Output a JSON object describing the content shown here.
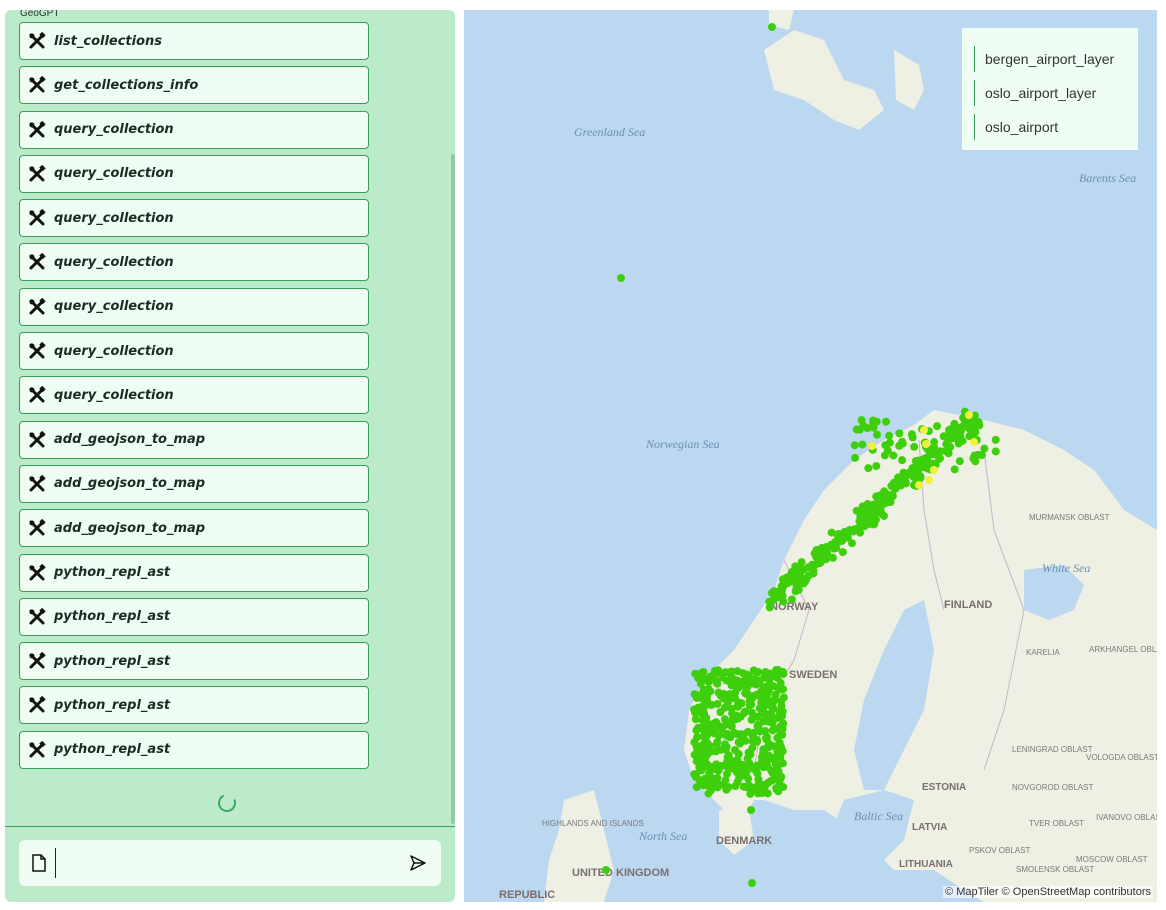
{
  "app": {
    "title": "GeoGPT"
  },
  "tools": [
    "list_collections",
    "get_collections_info",
    "query_collection",
    "query_collection",
    "query_collection",
    "query_collection",
    "query_collection",
    "query_collection",
    "query_collection",
    "add_geojson_to_map",
    "add_geojson_to_map",
    "add_geojson_to_map",
    "python_repl_ast",
    "python_repl_ast",
    "python_repl_ast",
    "python_repl_ast",
    "python_repl_ast"
  ],
  "chat_input": {
    "value": ""
  },
  "map": {
    "legend": [
      "bergen_airport_layer",
      "oslo_airport_layer",
      "oslo_airport"
    ],
    "labels": {
      "greenland_sea": "Greenland Sea",
      "barents_sea": "Barents Sea",
      "norwegian_sea": "Norwegian Sea",
      "norway": "NORWAY",
      "sweden": "SWEDEN",
      "finland": "FINLAND",
      "white_sea": "White Sea",
      "murmansk": "MURMANSK OBLAST",
      "karelia": "KARELIA",
      "arkhangelsk": "ARKHANGEL OBLAST",
      "leningrad": "LENINGRAD OBLAST",
      "vologda": "VOLOGDA OBLAST",
      "estonia": "ESTONIA",
      "novgorod": "NOVGOROD OBLAST",
      "latvia": "LATVIA",
      "tver": "TVER OBLAST",
      "ivanovo": "IVANOVO OBLAST",
      "pskov": "PSKOV OBLAST",
      "lithuania": "LITHUANIA",
      "smolensk": "SMOLENSK OBLAST",
      "moscow": "MOSCOW OBLAST",
      "baltic_sea": "Baltic Sea",
      "north_sea": "North Sea",
      "denmark": "DENMARK",
      "highlands": "HIGHLANDS AND ISLANDS",
      "united_kingdom": "UNITED KINGDOM",
      "republic": "REPUBLIC"
    },
    "attribution": "© MapTiler © OpenStreetMap contributors",
    "colors": {
      "water": "#bcd7f0",
      "land": "#eef0e4",
      "points_green": "#3ecf0c",
      "points_yellow": "#f4ef3c"
    }
  }
}
